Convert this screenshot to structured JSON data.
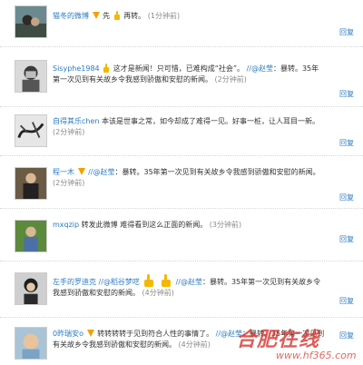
{
  "comments": [
    {
      "user": "猫冬的微博",
      "text_a": "先",
      "text_b": "再转。",
      "time": "(1分钟前)",
      "reply": "回复"
    },
    {
      "user": "Sisyphe1984",
      "text_a": "这才是新闻！只可惜，已难构成“社会”。",
      "at": "//@赵莹",
      "text_b": "：暴转。35年第一次见到有关故乡令我感到骄傲和安慰的新闻。",
      "time": "(2分钟前)",
      "reply": "回复"
    },
    {
      "user": "自得其乐chen",
      "text_a": "本该是世事之常，如今却成了难得一见。好事一桩，让人耳目一新。",
      "time": "(2分钟前)",
      "reply": "回复"
    },
    {
      "user": "程一木",
      "at": "//@赵莹",
      "text_b": "：暴转。35年第一次见到有关故乡令我感到骄傲和安慰的新闻。",
      "time": "(2分钟前)",
      "reply": "回复"
    },
    {
      "user": "mxqzip",
      "text_a": "转发此微博 难得看到这么正面的新闻。",
      "time": "(3分钟前)",
      "reply": "回复"
    },
    {
      "user": "左手的罗迪克",
      "at": "//@稻谷梦呓",
      "at2": "//@赵莹",
      "text_b": "：暴转。35年第一次见到有关故乡令我感到骄傲和安慰的新闻。",
      "time": "(4分钟前)",
      "reply": "回复"
    },
    {
      "user": "0昨瑞安o",
      "text_a": "转转转转于见到符合人性的事情了。",
      "at": "//@赵莹",
      "text_b": "：暴转。35年第一次见到有关故乡令我感到骄傲和安慰的新闻。",
      "time": "(4分钟前)",
      "reply": "回复"
    }
  ],
  "watermark": {
    "logo": "合肥在线",
    "url": "www.hf365.com"
  },
  "colors": {
    "link": "#2c7bc2",
    "time": "#8a8a8a",
    "badge": "#f2a100",
    "watermark": "#d6342e"
  }
}
